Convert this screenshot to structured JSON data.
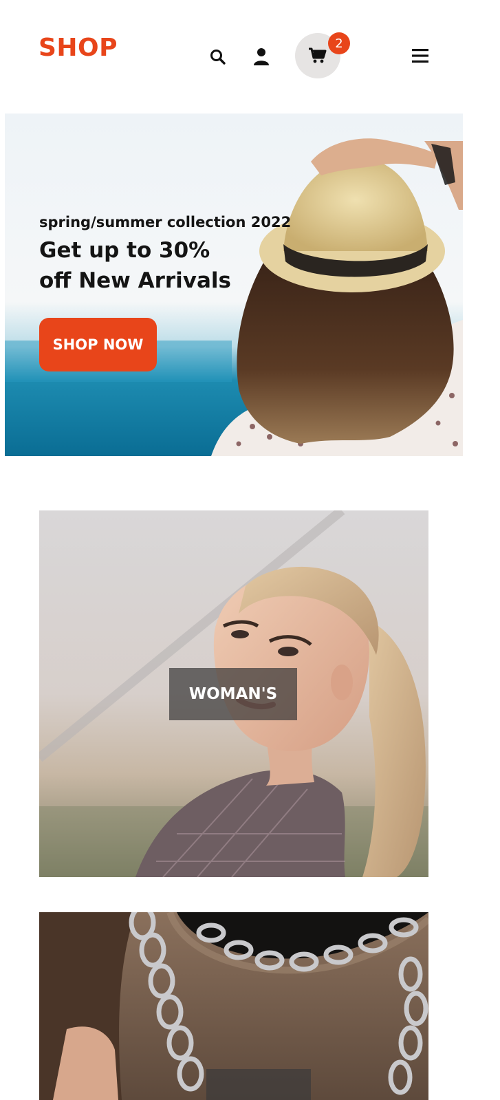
{
  "header": {
    "logo": "SHOP",
    "icons": [
      "search-icon",
      "user-icon",
      "cart-icon",
      "menu-icon"
    ],
    "cart_count": "2"
  },
  "hero": {
    "eyebrow": "spring/summer collection 2022",
    "title_line1": "Get up to 30%",
    "title_line2": "off New Arrivals",
    "cta_label": "SHOP NOW"
  },
  "categories": [
    {
      "label": "WOMAN'S"
    },
    {
      "label": ""
    }
  ],
  "colors": {
    "accent": "#e8451a",
    "text": "#141414",
    "cart_circle": "#e6e4e3"
  }
}
